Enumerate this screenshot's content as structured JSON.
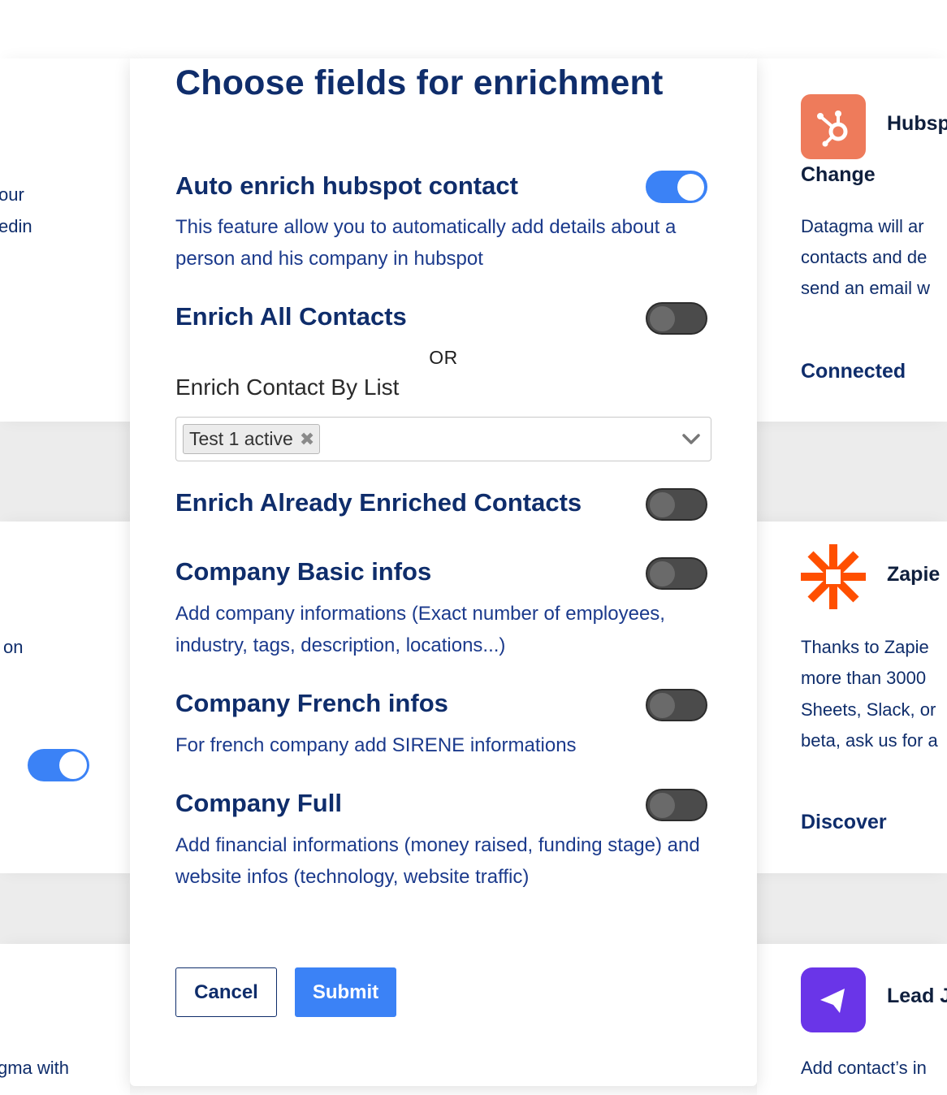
{
  "background": {
    "left_cards": [
      {
        "lines": [
          "our",
          "edin"
        ]
      },
      {
        "lines": [
          "on"
        ]
      },
      {
        "lines": [
          "gma with"
        ]
      }
    ],
    "right_cards": [
      {
        "app_name": "Hubsp",
        "action": "Change",
        "description": [
          "Datagma will ar",
          "contacts and de",
          "send an email w"
        ],
        "link": "Connected",
        "logo": "hubspot-icon"
      },
      {
        "app_name": "Zapie",
        "description": [
          "Thanks to Zapie",
          "more than 3000",
          "Sheets, Slack, or",
          "beta, ask us for a"
        ],
        "link": "Discover",
        "logo": "zapier-icon"
      },
      {
        "app_name": "Lead J",
        "description": [
          "Add contact’s in"
        ],
        "logo": "lemlist-icon"
      }
    ]
  },
  "modal": {
    "title": "Choose fields for enrichment",
    "settings": [
      {
        "title": "Auto enrich hubspot contact",
        "description": "This feature allow you to automatically add details about a person and his company in hubspot",
        "enabled": true
      },
      {
        "title": "Enrich All Contacts",
        "enabled": false
      },
      {
        "title": "Enrich Already Enriched Contacts",
        "enabled": false
      },
      {
        "title": "Company Basic infos",
        "description": "Add company informations (Exact number of employees, industry, tags, description, locations...)",
        "enabled": false
      },
      {
        "title": "Company French infos",
        "description": "For french company add SIRENE informations",
        "enabled": false
      },
      {
        "title": "Company Full",
        "description": "Add financial informations (money raised, funding stage) and website infos (technology, website traffic)",
        "enabled": false
      }
    ],
    "or_label": "OR",
    "list_label": "Enrich Contact By List",
    "list_selected": [
      "Test 1 active"
    ],
    "cancel_label": "Cancel",
    "submit_label": "Submit"
  },
  "colors": {
    "primary": "#0f2d6b",
    "accent": "#3b82f6",
    "toggle_off": "#4b4b4b",
    "hubspot": "#ee7b5b",
    "zapier": "#ff4f00",
    "lemlist": "#6a35e8"
  }
}
